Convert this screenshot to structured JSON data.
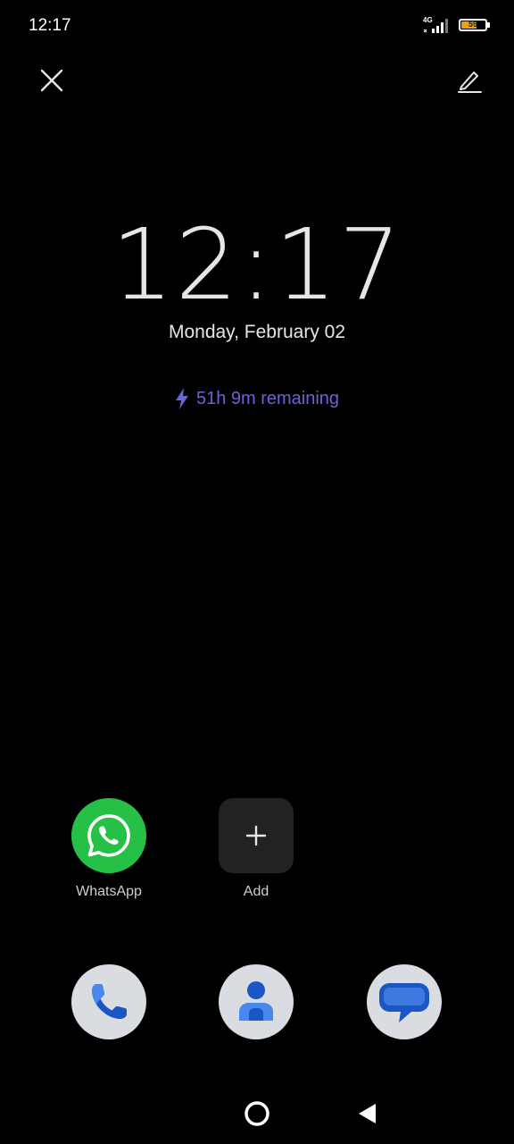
{
  "status_bar": {
    "time": "12:17",
    "network": "4G",
    "battery": "59",
    "battery_level": 0.59
  },
  "lockscreen": {
    "time": "12:17",
    "date": "Monday, February 02",
    "charging_text": "51h 9m remaining"
  },
  "shortcuts": [
    {
      "label": "WhatsApp",
      "icon": "whatsapp-icon"
    },
    {
      "label": "Add",
      "icon": "plus-icon"
    }
  ],
  "dock": [
    {
      "icon": "phone-icon"
    },
    {
      "icon": "contacts-icon"
    },
    {
      "icon": "messages-icon"
    }
  ],
  "colors": {
    "background": "#000000",
    "charge_accent": "#6b63d8",
    "whatsapp_green": "#25c045",
    "battery_fill": "#e6a019",
    "app_blue": "#1a56c4"
  }
}
